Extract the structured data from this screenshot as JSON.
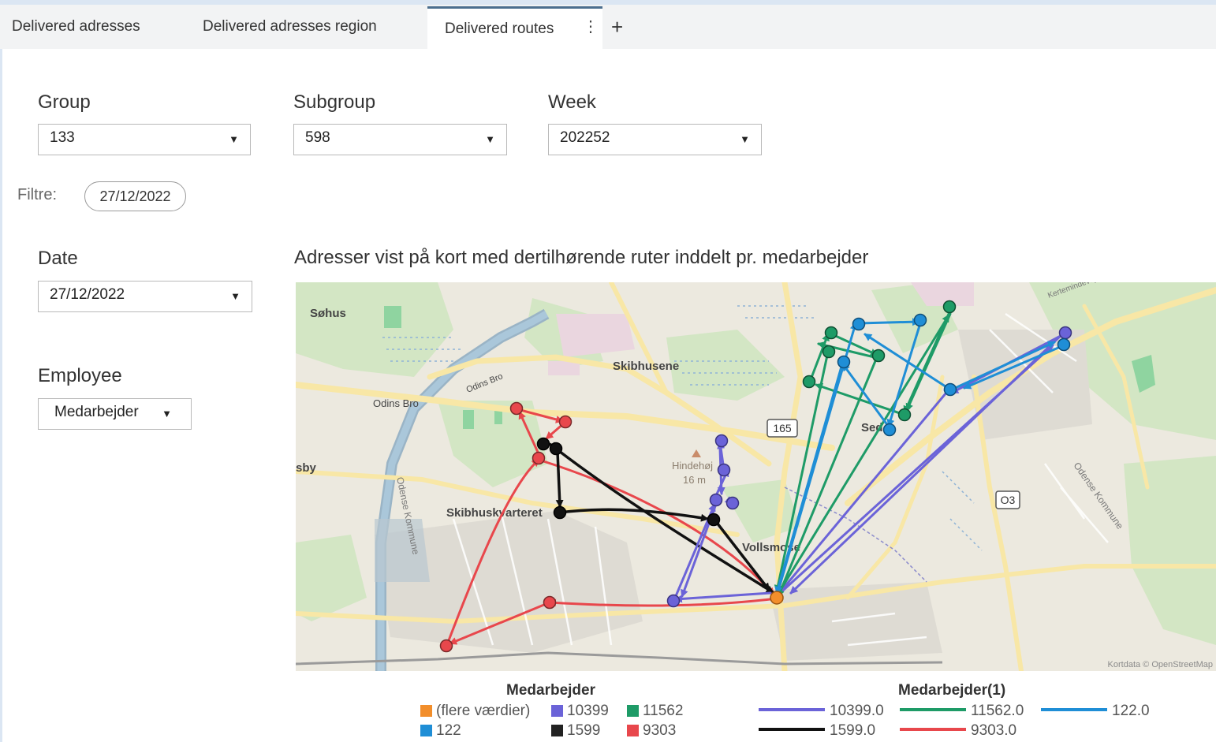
{
  "tabs": [
    {
      "label": "Delivered adresses",
      "active": false
    },
    {
      "label": "Delivered adresses region",
      "active": false
    },
    {
      "label": "Delivered routes",
      "active": true
    }
  ],
  "tab_menu_glyph": "⋮",
  "tab_add_glyph": "+",
  "filters": {
    "group": {
      "label": "Group",
      "value": "133"
    },
    "subgroup": {
      "label": "Subgroup",
      "value": "598"
    },
    "week": {
      "label": "Week",
      "value": "202252"
    },
    "filter_label": "Filtre:",
    "filter_chip": "27/12/2022",
    "date": {
      "label": "Date",
      "value": "27/12/2022"
    },
    "employee": {
      "label": "Employee",
      "value": "Medarbejder"
    }
  },
  "dropdown_arrow": "▼",
  "map": {
    "title": "Adresser vist på kort med dertilhørende ruter inddelt pr. medarbejder",
    "attribution": "Kortdata © OpenStreetMap",
    "place_labels": [
      "Søhus",
      "Skibhusene",
      "Odins Bro",
      "Odins Bro",
      "sby",
      "Skibhuskvarteret",
      "Hindehøj",
      "16 m",
      "Vollsmose",
      "Sed",
      "165",
      "O3",
      "Odense Kommune",
      "Odense Kommune",
      "Kertemindevej"
    ],
    "colors": {
      "orange": "#f28e2b",
      "purple": "#6b63d8",
      "green": "#1e9b67",
      "blue": "#1f8ed6",
      "black": "#111111",
      "red": "#e8474c"
    }
  },
  "legend_points": {
    "title": "Medarbejder",
    "items": [
      {
        "label": "(flere værdier)",
        "color": "#f28e2b"
      },
      {
        "label": "10399",
        "color": "#6b63d8"
      },
      {
        "label": "11562",
        "color": "#1e9b67"
      },
      {
        "label": "122",
        "color": "#1f8ed6"
      },
      {
        "label": "1599",
        "color": "#222222"
      },
      {
        "label": "9303",
        "color": "#e8474c"
      }
    ]
  },
  "legend_lines": {
    "title": "Medarbejder(1)",
    "items": [
      {
        "label": "10399.0",
        "color": "#6b63d8"
      },
      {
        "label": "11562.0",
        "color": "#1e9b67"
      },
      {
        "label": "122.0",
        "color": "#1f8ed6"
      },
      {
        "label": "1599.0",
        "color": "#111111"
      },
      {
        "label": "9303.0",
        "color": "#e8474c"
      }
    ]
  }
}
